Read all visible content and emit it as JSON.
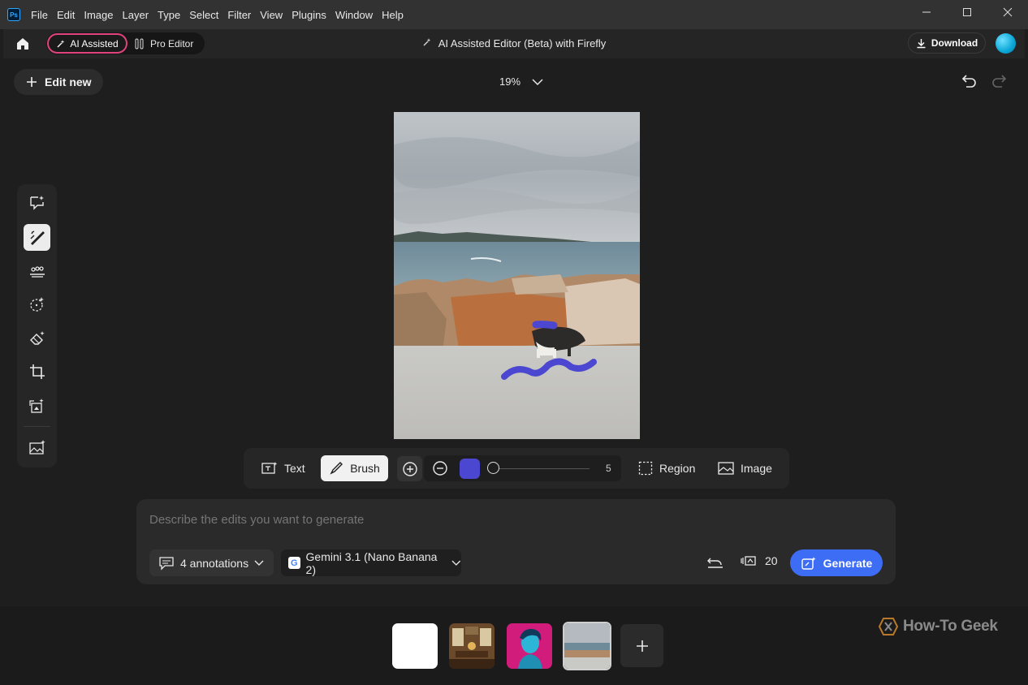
{
  "app": {
    "logo": "Ps",
    "menu": [
      "File",
      "Edit",
      "Image",
      "Layer",
      "Type",
      "Select",
      "Filter",
      "View",
      "Plugins",
      "Window",
      "Help"
    ]
  },
  "header": {
    "mode_ai": "AI Assisted",
    "mode_pro": "Pro Editor",
    "title": "AI Assisted Editor (Beta) with Firefly",
    "download": "Download"
  },
  "canvas": {
    "edit_new": "Edit new",
    "zoom": "19%"
  },
  "tools": [
    "chat-sparkle-icon",
    "brush-edit-icon",
    "adjust-sliders-icon",
    "select-sparkle-icon",
    "remove-eraser-icon",
    "crop-icon",
    "expand-sparkle-icon",
    "image-sparkle-icon"
  ],
  "brushbar": {
    "text": "Text",
    "brush": "Brush",
    "size_value": "5",
    "brush_color": "#4b47d0",
    "region": "Region",
    "image": "Image"
  },
  "prompt": {
    "placeholder": "Describe the edits you want to generate",
    "annotations": "4 annotations",
    "model": "Gemini 3.1 (Nano Banana 2)",
    "credits": "20",
    "generate": "Generate"
  },
  "watermark": "How-To Geek",
  "colors": {
    "accent": "#3d6df5",
    "ai_mode_border": "#e0427b",
    "background": "#1e1e1e"
  }
}
